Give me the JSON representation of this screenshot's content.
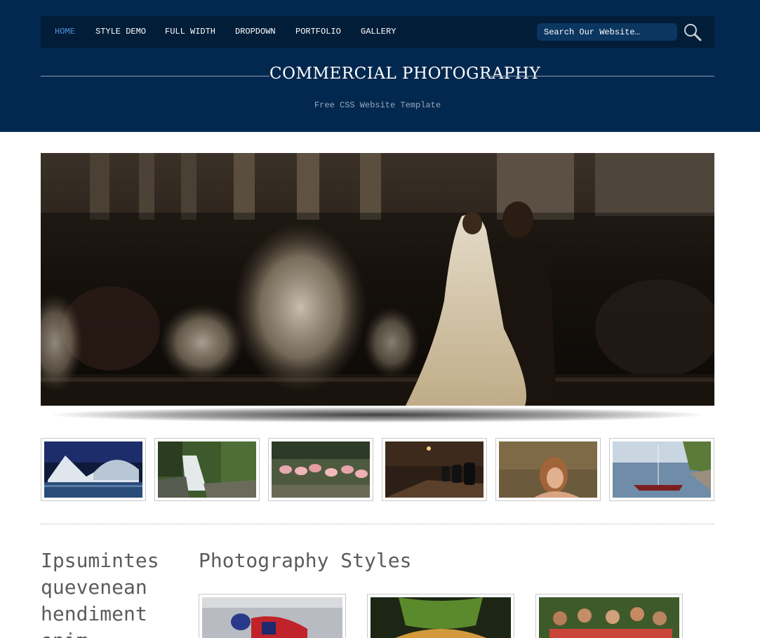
{
  "nav": {
    "items": [
      {
        "label": "HOME",
        "active": true
      },
      {
        "label": "STYLE DEMO",
        "active": false
      },
      {
        "label": "FULL WIDTH",
        "active": false
      },
      {
        "label": "DROPDOWN",
        "active": false
      },
      {
        "label": "PORTFOLIO",
        "active": false
      },
      {
        "label": "GALLERY",
        "active": false
      }
    ],
    "search_placeholder": "Search Our Website…"
  },
  "site": {
    "title": "COMMERCIAL PHOTOGRAPHY",
    "subtitle": "Free CSS Website Template"
  },
  "colors": {
    "header_bg": "#03284f",
    "nav_bg": "#021d38",
    "active_nav": "#4f93de",
    "heading_text": "#5c5c5c"
  },
  "content": {
    "left_heading": "Ipsumintes quevenean hendiment enim",
    "right_heading": "Photography Styles"
  }
}
